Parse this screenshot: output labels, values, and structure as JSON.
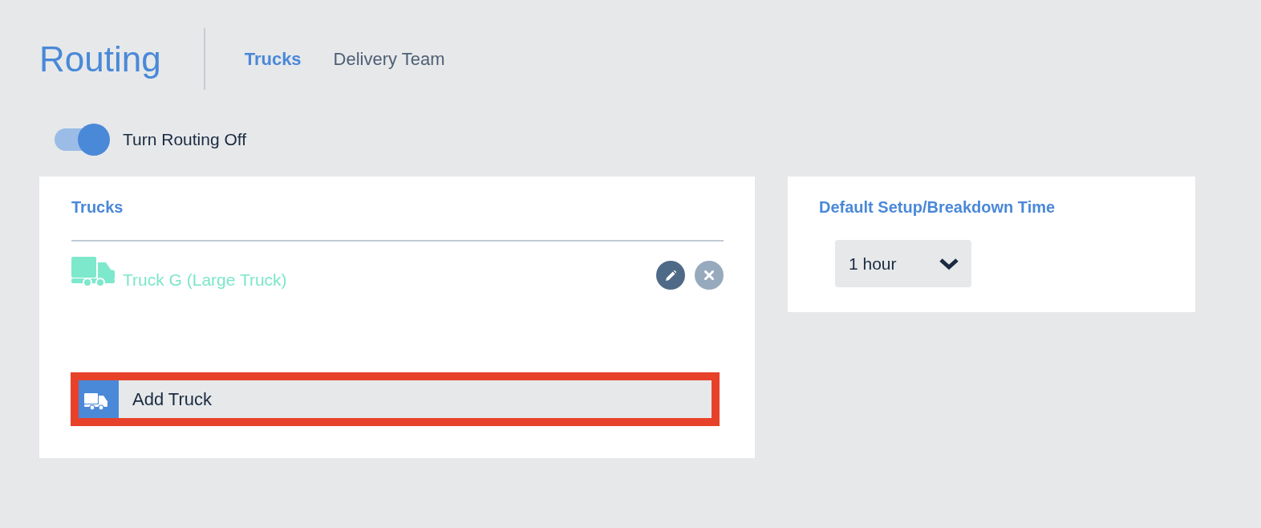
{
  "header": {
    "title": "Routing",
    "tabs": [
      {
        "label": "Trucks",
        "selected": true
      },
      {
        "label": "Delivery Team",
        "selected": false
      }
    ]
  },
  "routing_toggle": {
    "label": "Turn Routing Off",
    "on": true
  },
  "trucks_panel": {
    "title": "Trucks",
    "trucks": [
      {
        "name": "Truck G (Large Truck)"
      }
    ],
    "add_button": {
      "label": "Add Truck",
      "highlighted": true
    }
  },
  "setup_panel": {
    "title": "Default Setup/Breakdown Time",
    "select": {
      "value": "1 hour"
    }
  }
}
